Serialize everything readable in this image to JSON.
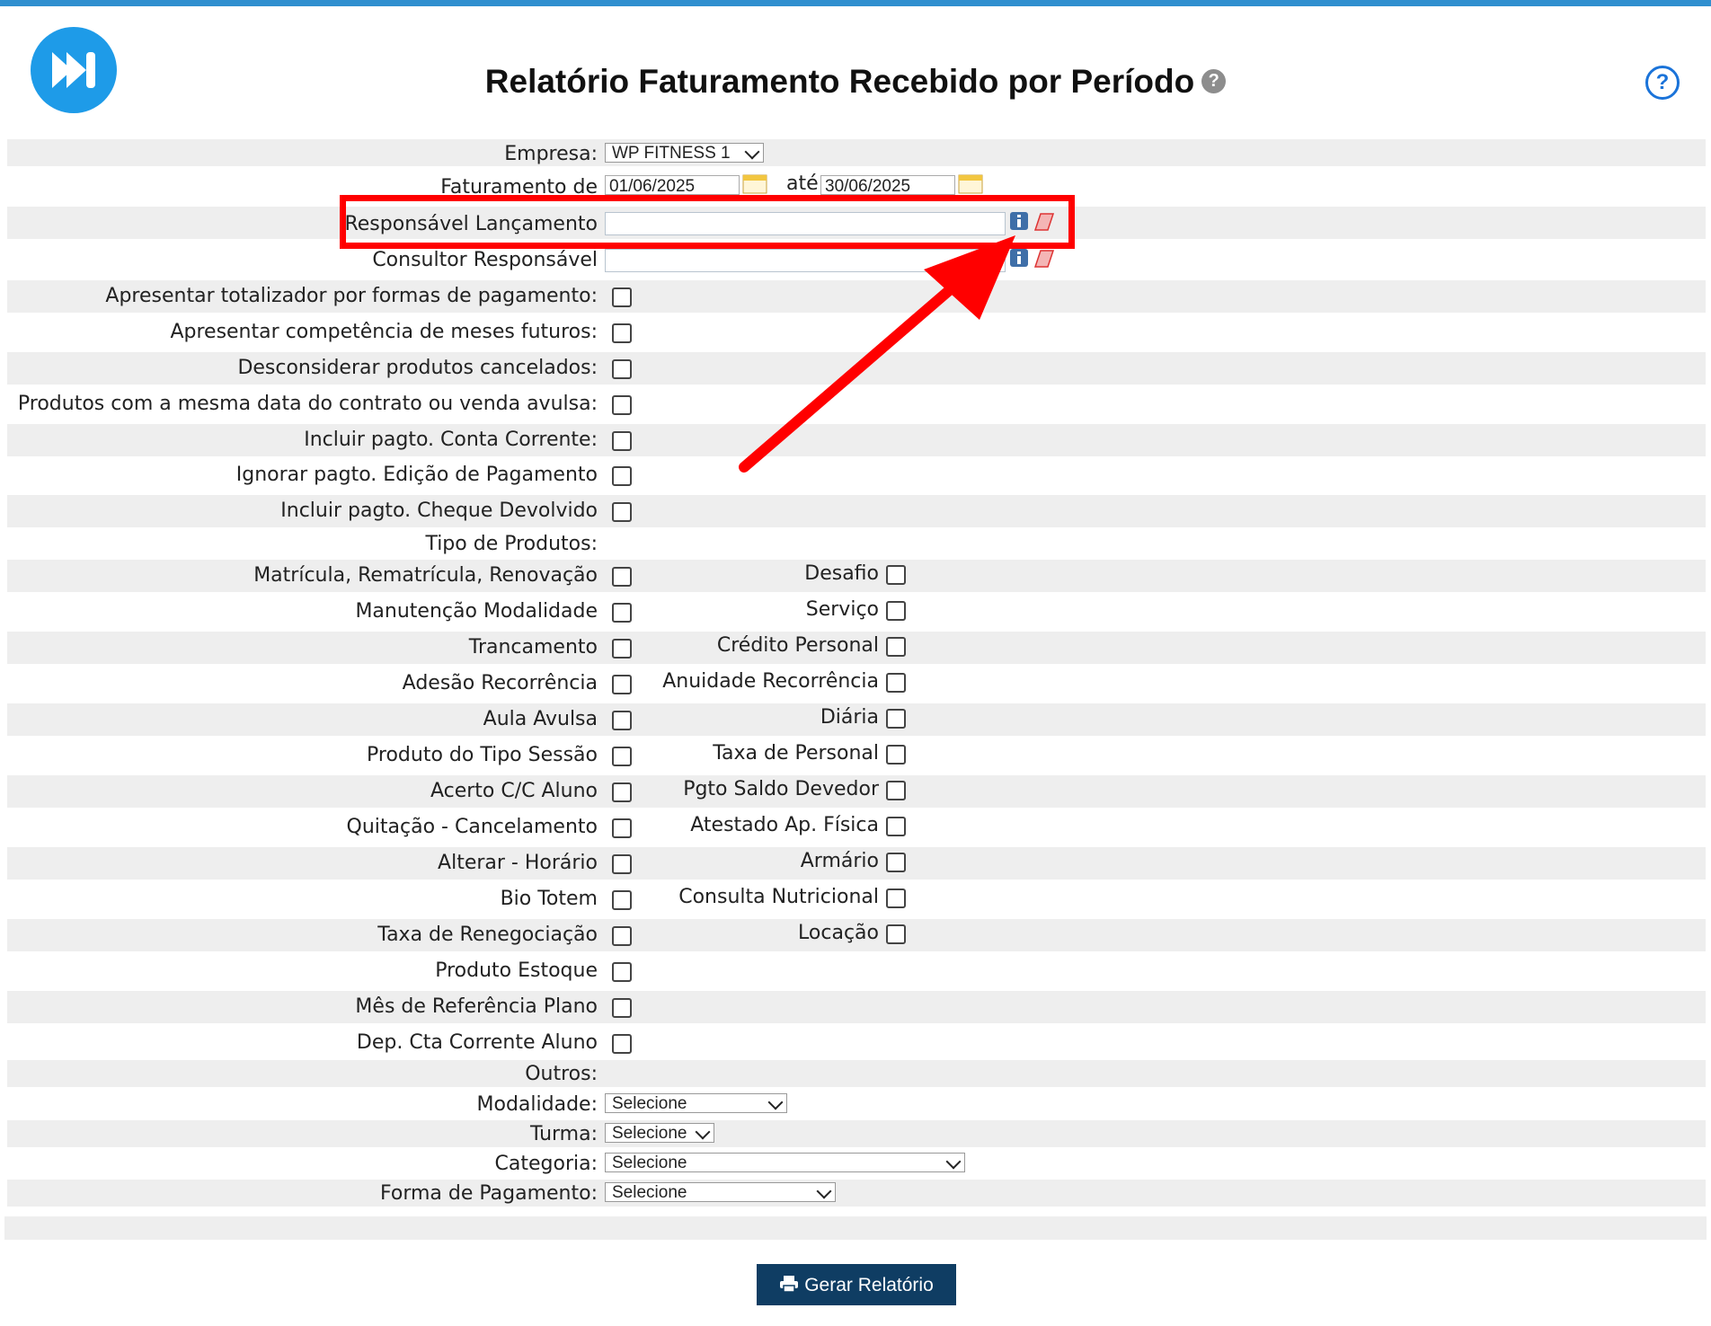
{
  "page": {
    "title": "Relatório Faturamento Recebido por Período",
    "help_mark": "?",
    "help_button": "?"
  },
  "filters": {
    "empresa_label": "Empresa:",
    "empresa_value": "WP FITNESS 1",
    "faturamento_label": "Faturamento de",
    "date_from": "01/06/2025",
    "ate_label": "até",
    "date_to": "30/06/2025",
    "responsavel_label": "Responsável Lançamento",
    "responsavel_value": "",
    "consultor_label": "Consultor Responsável",
    "consultor_value": ""
  },
  "options": [
    {
      "label": "Apresentar totalizador por formas de pagamento:",
      "checked": false
    },
    {
      "label": "Apresentar competência de meses futuros:",
      "checked": false
    },
    {
      "label": "Desconsiderar produtos cancelados:",
      "checked": false
    },
    {
      "label": "Produtos com a mesma data do contrato ou venda avulsa:",
      "checked": false
    },
    {
      "label": "Incluir pagto. Conta Corrente:",
      "checked": false
    },
    {
      "label": "Ignorar pagto. Edição de Pagamento",
      "checked": false
    },
    {
      "label": "Incluir pagto. Cheque Devolvido",
      "checked": false
    }
  ],
  "tipo_produtos_label": "Tipo de Produtos:",
  "tipo_produtos": [
    {
      "left": "Matrícula, Rematrícula, Renovação",
      "right": "Desafio"
    },
    {
      "left": "Manutenção Modalidade",
      "right": "Serviço"
    },
    {
      "left": "Trancamento",
      "right": "Crédito Personal"
    },
    {
      "left": "Adesão Recorrência",
      "right": "Anuidade Recorrência"
    },
    {
      "left": "Aula Avulsa",
      "right": "Diária"
    },
    {
      "left": "Produto do Tipo Sessão",
      "right": "Taxa de Personal"
    },
    {
      "left": "Acerto C/C Aluno",
      "right": "Pgto Saldo Devedor"
    },
    {
      "left": "Quitação - Cancelamento",
      "right": "Atestado Ap. Física"
    },
    {
      "left": "Alterar - Horário",
      "right": "Armário"
    },
    {
      "left": "Bio Totem",
      "right": "Consulta Nutricional"
    },
    {
      "left": "Taxa de Renegociação",
      "right": "Locação"
    },
    {
      "left": "Produto Estoque",
      "right": ""
    },
    {
      "left": "Mês de Referência Plano",
      "right": ""
    },
    {
      "left": "Dep. Cta Corrente Aluno",
      "right": ""
    }
  ],
  "outros": {
    "label": "Outros:",
    "modalidade_label": "Modalidade:",
    "modalidade_value": "Selecione",
    "turma_label": "Turma:",
    "turma_value": "Selecione",
    "categoria_label": "Categoria:",
    "categoria_value": "Selecione",
    "forma_label": "Forma de Pagamento:",
    "forma_value": "Selecione"
  },
  "actions": {
    "gerar_label": "Gerar Relatório"
  },
  "colors": {
    "accent": "#1e9be8",
    "button": "#0f3d63",
    "highlight": "#ff0000",
    "row_shade": "#eeeeee"
  }
}
